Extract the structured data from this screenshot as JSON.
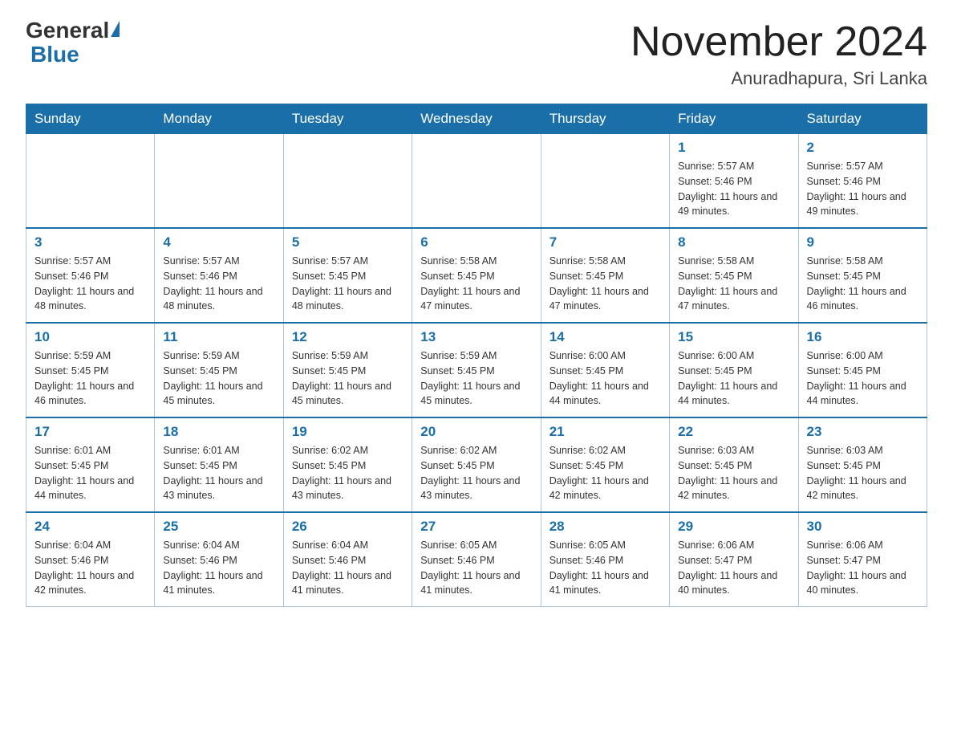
{
  "header": {
    "logo_general": "General",
    "logo_blue": "Blue",
    "title": "November 2024",
    "subtitle": "Anuradhapura, Sri Lanka"
  },
  "weekdays": [
    "Sunday",
    "Monday",
    "Tuesday",
    "Wednesday",
    "Thursday",
    "Friday",
    "Saturday"
  ],
  "weeks": [
    [
      {
        "day": "",
        "sunrise": "",
        "sunset": "",
        "daylight": "",
        "empty": true
      },
      {
        "day": "",
        "sunrise": "",
        "sunset": "",
        "daylight": "",
        "empty": true
      },
      {
        "day": "",
        "sunrise": "",
        "sunset": "",
        "daylight": "",
        "empty": true
      },
      {
        "day": "",
        "sunrise": "",
        "sunset": "",
        "daylight": "",
        "empty": true
      },
      {
        "day": "",
        "sunrise": "",
        "sunset": "",
        "daylight": "",
        "empty": true
      },
      {
        "day": "1",
        "sunrise": "Sunrise: 5:57 AM",
        "sunset": "Sunset: 5:46 PM",
        "daylight": "Daylight: 11 hours and 49 minutes.",
        "empty": false
      },
      {
        "day": "2",
        "sunrise": "Sunrise: 5:57 AM",
        "sunset": "Sunset: 5:46 PM",
        "daylight": "Daylight: 11 hours and 49 minutes.",
        "empty": false
      }
    ],
    [
      {
        "day": "3",
        "sunrise": "Sunrise: 5:57 AM",
        "sunset": "Sunset: 5:46 PM",
        "daylight": "Daylight: 11 hours and 48 minutes.",
        "empty": false
      },
      {
        "day": "4",
        "sunrise": "Sunrise: 5:57 AM",
        "sunset": "Sunset: 5:46 PM",
        "daylight": "Daylight: 11 hours and 48 minutes.",
        "empty": false
      },
      {
        "day": "5",
        "sunrise": "Sunrise: 5:57 AM",
        "sunset": "Sunset: 5:45 PM",
        "daylight": "Daylight: 11 hours and 48 minutes.",
        "empty": false
      },
      {
        "day": "6",
        "sunrise": "Sunrise: 5:58 AM",
        "sunset": "Sunset: 5:45 PM",
        "daylight": "Daylight: 11 hours and 47 minutes.",
        "empty": false
      },
      {
        "day": "7",
        "sunrise": "Sunrise: 5:58 AM",
        "sunset": "Sunset: 5:45 PM",
        "daylight": "Daylight: 11 hours and 47 minutes.",
        "empty": false
      },
      {
        "day": "8",
        "sunrise": "Sunrise: 5:58 AM",
        "sunset": "Sunset: 5:45 PM",
        "daylight": "Daylight: 11 hours and 47 minutes.",
        "empty": false
      },
      {
        "day": "9",
        "sunrise": "Sunrise: 5:58 AM",
        "sunset": "Sunset: 5:45 PM",
        "daylight": "Daylight: 11 hours and 46 minutes.",
        "empty": false
      }
    ],
    [
      {
        "day": "10",
        "sunrise": "Sunrise: 5:59 AM",
        "sunset": "Sunset: 5:45 PM",
        "daylight": "Daylight: 11 hours and 46 minutes.",
        "empty": false
      },
      {
        "day": "11",
        "sunrise": "Sunrise: 5:59 AM",
        "sunset": "Sunset: 5:45 PM",
        "daylight": "Daylight: 11 hours and 45 minutes.",
        "empty": false
      },
      {
        "day": "12",
        "sunrise": "Sunrise: 5:59 AM",
        "sunset": "Sunset: 5:45 PM",
        "daylight": "Daylight: 11 hours and 45 minutes.",
        "empty": false
      },
      {
        "day": "13",
        "sunrise": "Sunrise: 5:59 AM",
        "sunset": "Sunset: 5:45 PM",
        "daylight": "Daylight: 11 hours and 45 minutes.",
        "empty": false
      },
      {
        "day": "14",
        "sunrise": "Sunrise: 6:00 AM",
        "sunset": "Sunset: 5:45 PM",
        "daylight": "Daylight: 11 hours and 44 minutes.",
        "empty": false
      },
      {
        "day": "15",
        "sunrise": "Sunrise: 6:00 AM",
        "sunset": "Sunset: 5:45 PM",
        "daylight": "Daylight: 11 hours and 44 minutes.",
        "empty": false
      },
      {
        "day": "16",
        "sunrise": "Sunrise: 6:00 AM",
        "sunset": "Sunset: 5:45 PM",
        "daylight": "Daylight: 11 hours and 44 minutes.",
        "empty": false
      }
    ],
    [
      {
        "day": "17",
        "sunrise": "Sunrise: 6:01 AM",
        "sunset": "Sunset: 5:45 PM",
        "daylight": "Daylight: 11 hours and 44 minutes.",
        "empty": false
      },
      {
        "day": "18",
        "sunrise": "Sunrise: 6:01 AM",
        "sunset": "Sunset: 5:45 PM",
        "daylight": "Daylight: 11 hours and 43 minutes.",
        "empty": false
      },
      {
        "day": "19",
        "sunrise": "Sunrise: 6:02 AM",
        "sunset": "Sunset: 5:45 PM",
        "daylight": "Daylight: 11 hours and 43 minutes.",
        "empty": false
      },
      {
        "day": "20",
        "sunrise": "Sunrise: 6:02 AM",
        "sunset": "Sunset: 5:45 PM",
        "daylight": "Daylight: 11 hours and 43 minutes.",
        "empty": false
      },
      {
        "day": "21",
        "sunrise": "Sunrise: 6:02 AM",
        "sunset": "Sunset: 5:45 PM",
        "daylight": "Daylight: 11 hours and 42 minutes.",
        "empty": false
      },
      {
        "day": "22",
        "sunrise": "Sunrise: 6:03 AM",
        "sunset": "Sunset: 5:45 PM",
        "daylight": "Daylight: 11 hours and 42 minutes.",
        "empty": false
      },
      {
        "day": "23",
        "sunrise": "Sunrise: 6:03 AM",
        "sunset": "Sunset: 5:45 PM",
        "daylight": "Daylight: 11 hours and 42 minutes.",
        "empty": false
      }
    ],
    [
      {
        "day": "24",
        "sunrise": "Sunrise: 6:04 AM",
        "sunset": "Sunset: 5:46 PM",
        "daylight": "Daylight: 11 hours and 42 minutes.",
        "empty": false
      },
      {
        "day": "25",
        "sunrise": "Sunrise: 6:04 AM",
        "sunset": "Sunset: 5:46 PM",
        "daylight": "Daylight: 11 hours and 41 minutes.",
        "empty": false
      },
      {
        "day": "26",
        "sunrise": "Sunrise: 6:04 AM",
        "sunset": "Sunset: 5:46 PM",
        "daylight": "Daylight: 11 hours and 41 minutes.",
        "empty": false
      },
      {
        "day": "27",
        "sunrise": "Sunrise: 6:05 AM",
        "sunset": "Sunset: 5:46 PM",
        "daylight": "Daylight: 11 hours and 41 minutes.",
        "empty": false
      },
      {
        "day": "28",
        "sunrise": "Sunrise: 6:05 AM",
        "sunset": "Sunset: 5:46 PM",
        "daylight": "Daylight: 11 hours and 41 minutes.",
        "empty": false
      },
      {
        "day": "29",
        "sunrise": "Sunrise: 6:06 AM",
        "sunset": "Sunset: 5:47 PM",
        "daylight": "Daylight: 11 hours and 40 minutes.",
        "empty": false
      },
      {
        "day": "30",
        "sunrise": "Sunrise: 6:06 AM",
        "sunset": "Sunset: 5:47 PM",
        "daylight": "Daylight: 11 hours and 40 minutes.",
        "empty": false
      }
    ]
  ]
}
